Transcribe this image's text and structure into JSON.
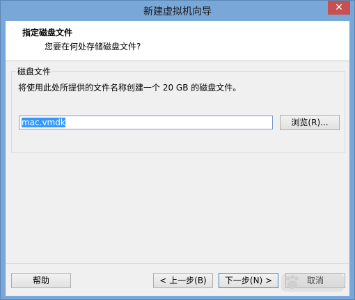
{
  "window": {
    "title": "新建虚拟机向导",
    "close_glyph": "✕"
  },
  "header": {
    "title": "指定磁盘文件",
    "subtitle": "您要在何处存储磁盘文件?"
  },
  "disk_file": {
    "group_label": "磁盘文件",
    "description": "将使用此处所提供的文件名称创建一个 20 GB 的磁盘文件。",
    "path_value": "mac.vmdk",
    "browse_label": "浏览(R)..."
  },
  "footer": {
    "help_label": "帮助",
    "back_label": "< 上一步(B)",
    "next_label": "下一步(N) >",
    "cancel_label": "取消"
  },
  "colors": {
    "titlebar": "#79a7d8",
    "close": "#c75050",
    "selection": "#3399ff"
  }
}
